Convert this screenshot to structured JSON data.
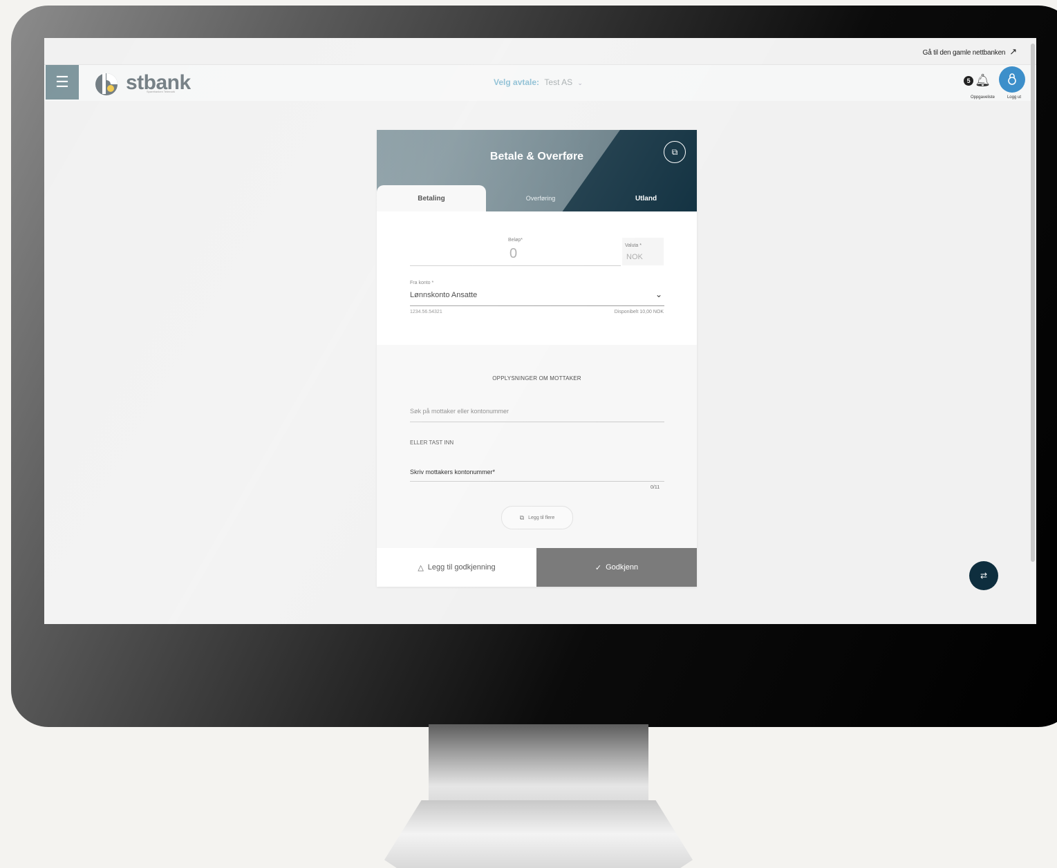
{
  "header": {
    "old_bank_link": "Gå til den gamle nettbanken",
    "brand": "stbank",
    "brand_sub": "Sparebanken Telemark",
    "agreement_label": "Velg avtale:",
    "agreement_value": "Test AS",
    "notification_count": "5",
    "tasks_label": "Oppgaveliste",
    "logout_label": "Logg ut"
  },
  "card": {
    "title": "Betale & Overføre",
    "tabs": [
      {
        "label": "Betaling",
        "active": true
      },
      {
        "label": "Overføring",
        "active": false
      },
      {
        "label": "Utland",
        "active": false
      }
    ],
    "amount": {
      "label": "Beløp*",
      "value": "0"
    },
    "currency": {
      "label": "Valuta *",
      "value": "NOK"
    },
    "from_account": {
      "label": "Fra konto *",
      "name": "Lønnskonto Ansatte",
      "number": "1234.56.54321",
      "available": "Disponibelt 10,00 NOK"
    },
    "recipient": {
      "section_title": "OPPLYSNINGER OM MOTTAKER",
      "search_placeholder": "Søk på mottaker eller kontonummer",
      "or_label": "ELLER TAST INN",
      "account_label": "Skriv mottakers kontonummer*",
      "counter": "0/11",
      "add_more": "Legg til flere"
    },
    "actions": {
      "add_approval": "Legg til godkjenning",
      "approve": "Godkjenn"
    }
  },
  "colors": {
    "accent_blue": "#3d8fca",
    "dark_navy": "#0e2e3e",
    "header_grey": "#7d929a"
  }
}
